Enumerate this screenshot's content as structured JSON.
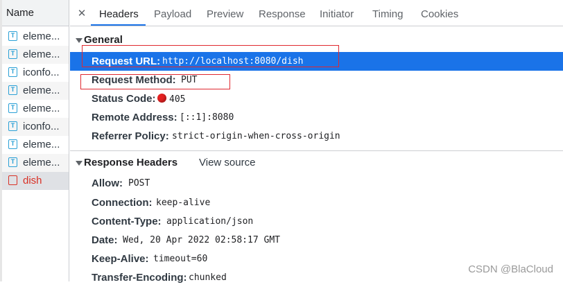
{
  "left_panel": {
    "header": "Name",
    "items": [
      {
        "label": "eleme...",
        "icon": "file-text-icon",
        "icon_glyph": "T"
      },
      {
        "label": "eleme...",
        "icon": "file-text-icon",
        "icon_glyph": "T"
      },
      {
        "label": "iconfo...",
        "icon": "file-text-icon",
        "icon_glyph": "T"
      },
      {
        "label": "eleme...",
        "icon": "file-text-icon",
        "icon_glyph": "T"
      },
      {
        "label": "eleme...",
        "icon": "file-text-icon",
        "icon_glyph": "T"
      },
      {
        "label": "iconfo...",
        "icon": "file-text-icon",
        "icon_glyph": "T"
      },
      {
        "label": "eleme...",
        "icon": "file-text-icon",
        "icon_glyph": "T"
      },
      {
        "label": "eleme...",
        "icon": "file-text-icon",
        "icon_glyph": "T"
      },
      {
        "label": "dish",
        "icon": "file-error-icon",
        "status": "error"
      }
    ]
  },
  "tabs": {
    "close": "✕",
    "items": [
      {
        "label": "Headers",
        "active": true
      },
      {
        "label": "Payload"
      },
      {
        "label": "Preview"
      },
      {
        "label": "Response"
      },
      {
        "label": "Initiator"
      },
      {
        "label": "Timing"
      },
      {
        "label": "Cookies"
      }
    ]
  },
  "general": {
    "title": "General",
    "rows": [
      {
        "key": "Request URL:",
        "value": "http://localhost:8080/dish",
        "highlighted": true
      },
      {
        "key": "Request Method:",
        "value": "PUT"
      },
      {
        "key": "Status Code:",
        "value": "405",
        "status_color": "#e52222"
      },
      {
        "key": "Remote Address:",
        "value": "[::1]:8080"
      },
      {
        "key": "Referrer Policy:",
        "value": "strict-origin-when-cross-origin"
      }
    ]
  },
  "response_headers": {
    "title": "Response Headers",
    "view_source": "View source",
    "rows": [
      {
        "key": "Allow:",
        "value": "POST"
      },
      {
        "key": "Connection:",
        "value": "keep-alive"
      },
      {
        "key": "Content-Type:",
        "value": "application/json"
      },
      {
        "key": "Date:",
        "value": "Wed, 20 Apr 2022 02:58:17 GMT"
      },
      {
        "key": "Keep-Alive:",
        "value": "timeout=60"
      },
      {
        "key": "Transfer-Encoding:",
        "value": "chunked"
      }
    ]
  },
  "watermark": "CSDN @BlaCloud",
  "colors": {
    "accent": "#1a73e8",
    "error": "#d93025",
    "annotation_box": "#e0282f"
  }
}
